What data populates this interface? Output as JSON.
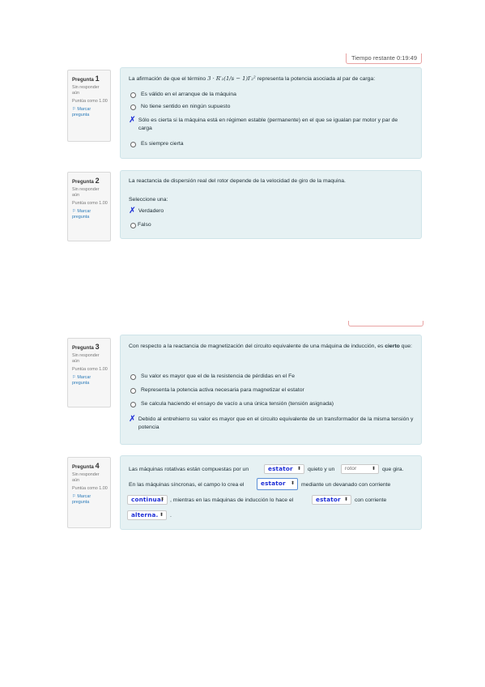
{
  "timer": {
    "label": "Tiempo restante 0:19:49"
  },
  "q1": {
    "label": "Pregunta",
    "number": "1",
    "status": "Sin responder aún",
    "score": "Puntúa como 1.00",
    "flag": "Marcar pregunta",
    "text_before": "La afirmación de que el término ",
    "formula": "3 · R′₂(1/s − 1)I′₂²",
    "text_after": " representa la potencia asociada al par de carga:",
    "options": [
      "Es válido en el arranque de la máquina",
      "No tiene sentido en ningún supuesto",
      "Sólo es cierta si la máquina está en régimen estable (permanente) en el que se igualan par motor y par de carga",
      "Es siempre cierta"
    ]
  },
  "q2": {
    "label": "Pregunta",
    "number": "2",
    "status": "Sin responder aún",
    "score": "Puntúa como 1.00",
    "flag": "Marcar pregunta",
    "text": "La reactancia de dispersión real del rotor depende de la velocidad de giro de la maquina.",
    "prompt": "Seleccione una:",
    "options": [
      "Verdadero",
      "Falso"
    ]
  },
  "q3": {
    "label": "Pregunta",
    "number": "3",
    "status": "Sin responder aún",
    "score": "Puntúa como 1.00",
    "flag": "Marcar pregunta",
    "text_before": "Con respecto a la reactancia de magnetización del circuito equivalente de una máquina de inducción, es ",
    "text_bold": "cierto",
    "text_after": " que:",
    "options": [
      "Su valor es mayor que el de la resistencia de pérdidas en el Fe",
      "Representa la potencia activa necesaria para magnetizar el estator",
      "Se calcula haciendo el ensayo de vacío a una única tensión (tensión asignada)",
      "Debido al entrehierro su valor es mayor que en el circuito equivalente de un transformador de la misma tensión y potencia"
    ]
  },
  "q4": {
    "label": "Pregunta",
    "number": "4",
    "status": "Sin responder aún",
    "score": "Puntúa como 1.00",
    "flag": "Marcar pregunta",
    "l1a": "Las máquinas rotativas están compuestas por un",
    "l1b": "quieto y un",
    "l1c": "que gira.",
    "l2a": "En las máquinas síncronas, el campo lo crea el",
    "l2b": "mediante un devanado con corriente",
    "l3a": ", mientras en las máquinas de inducción lo hace el",
    "l3b": "con corriente",
    "l4a": ".",
    "selects": [
      "estator",
      "rotor",
      "estator",
      "continua.",
      "estator",
      "alterna."
    ]
  }
}
